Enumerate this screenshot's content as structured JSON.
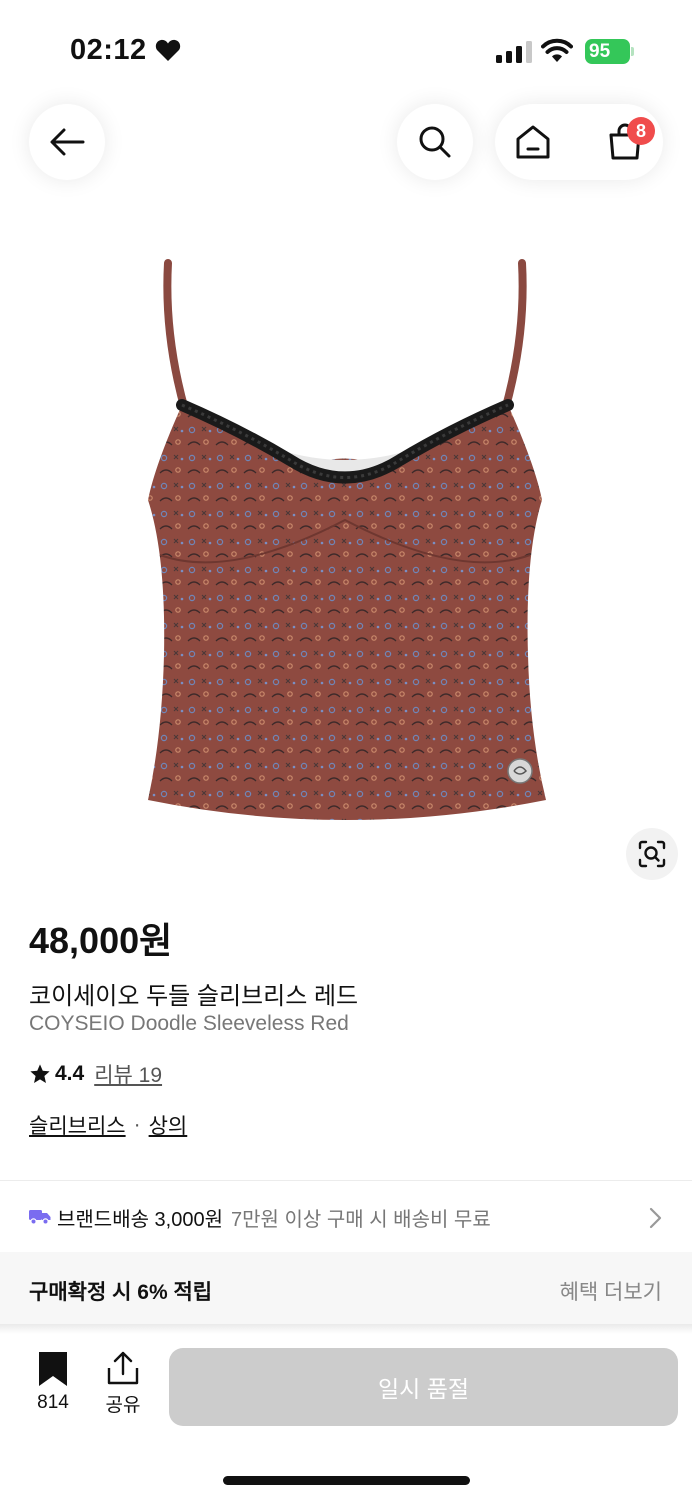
{
  "status_bar": {
    "time": "02:12",
    "battery": "95",
    "icons": [
      "heart-icon",
      "signal-icon",
      "wifi-icon",
      "battery-icon"
    ]
  },
  "header": {
    "back_icon": "arrow-left-icon",
    "search_icon": "search-icon",
    "home_icon": "home-icon",
    "cart_icon": "shopping-bag-icon",
    "cart_badge": "8"
  },
  "product": {
    "image": "sleeveless-camisole-red-doodle",
    "lens_icon": "image-search-icon",
    "price": "48,000원",
    "name_ko": "코이세이오 두들 슬리브리스 레드",
    "name_en": "COYSEIO Doodle Sleeveless Red",
    "rating": "4.4",
    "reviews": "리뷰 19",
    "categories": [
      "슬리브리스",
      "상의"
    ],
    "category_separator": "·"
  },
  "delivery": {
    "icon": "truck-icon",
    "main": "브랜드배송 3,000원",
    "sub": "7만원 이상 구매 시 배송비 무료"
  },
  "benefit": {
    "text": "구매확정 시 6% 적립",
    "more": "혜택 더보기"
  },
  "bottom_bar": {
    "bookmark_count": "814",
    "share_label": "공유",
    "soldout_label": "일시 품절"
  },
  "colors": {
    "accent_green": "#34c759",
    "badge_red": "#f04c4c",
    "product_red": "#8e4a40",
    "truck_purple": "#7a6cf0",
    "disabled_button": "#cccccc"
  }
}
